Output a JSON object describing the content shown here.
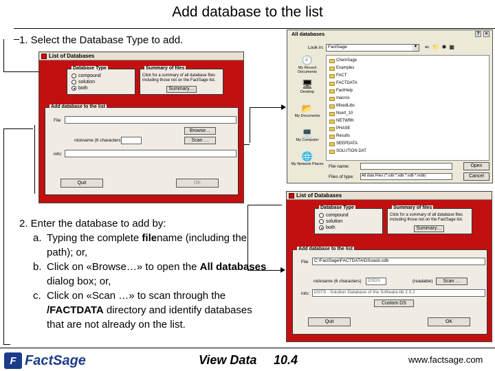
{
  "page": {
    "title": "Add database to the list",
    "step1": "1. Select the Database Type to add.",
    "step2": {
      "intro": "2. Enter the database to add by:",
      "items": [
        {
          "marker": "a.",
          "parts": [
            {
              "t": "Typing the complete ",
              "b": false
            },
            {
              "t": "file",
              "b": true
            },
            {
              "t": "name (including the path); or,",
              "b": false
            }
          ]
        },
        {
          "marker": "b.",
          "parts": [
            {
              "t": "Click on «Browse…» to open the ",
              "b": false
            },
            {
              "t": "All databases",
              "b": true
            },
            {
              "t": " dialog box; or,",
              "b": false
            }
          ]
        },
        {
          "marker": "c.",
          "parts": [
            {
              "t": "Click on «Scan …» to scan through the ",
              "b": false
            },
            {
              "t": "/FACTDATA",
              "b": true
            },
            {
              "t": " directory and identify databases that are not already on the list.",
              "b": false
            }
          ]
        }
      ]
    },
    "footer": {
      "logo": "FactSage",
      "view_data": "View Data",
      "page_number": "10.4",
      "url": "www.factsage.com"
    }
  },
  "dialog1": {
    "title": "List of Databases",
    "db_type_legend": "Database Type",
    "radios": [
      {
        "label": "compound",
        "checked": false
      },
      {
        "label": "solution",
        "checked": false
      },
      {
        "label": "both",
        "checked": true
      }
    ],
    "summary_legend": "Summary of files",
    "summary_text": "Click for a summary of all database files including those not on the FactSage list.",
    "summary_button": "Summary…",
    "add_legend": "Add database to the list",
    "file_label": "File",
    "file_value": "",
    "nick_label": "nickname (6 characters)",
    "nick_value": "",
    "info_label": "info:",
    "browse_button": "Browse…",
    "scan_button": "Scan …",
    "quit_button": "Quit",
    "ok_button": "OK"
  },
  "file_dialog": {
    "title": "All databases",
    "lookin_label": "Look in:",
    "lookin_value": "FactSage",
    "places": [
      "My Recent Documents",
      "Desktop",
      "My Documents",
      "My Computer",
      "My Network Places"
    ],
    "files": [
      "ChemSage",
      "Examples",
      "FACT",
      "FACTDATA",
      "FactHelp",
      "macros",
      "MixedLibs",
      "Nsert_10",
      "NETWRK",
      "PHASE",
      "Results",
      "SEEPDATA",
      "SOLUTION DAT"
    ],
    "filename_label": "File name:",
    "filetype_label": "Files of type:",
    "filetype_value": "All data Files (*.cdb *.sdb *.odb *.mdb)",
    "open_button": "Open",
    "cancel_button": "Cancel"
  },
  "dialog2": {
    "title": "List of Databases",
    "db_type_legend": "Database Type",
    "radios": [
      {
        "label": "compound",
        "checked": false
      },
      {
        "label": "solution",
        "checked": false
      },
      {
        "label": "both",
        "checked": true
      }
    ],
    "summary_legend": "Summary of files",
    "summary_text": "Click for a summary of all database files including those not on the FactSage list.",
    "summary_button": "Summary…",
    "add_legend": "Add database to the list",
    "file_label": "File",
    "file_value": "C:\\FactSage\\FACTDATA\\DSoasb.cdb",
    "nick_label": "nickname (6 characters)",
    "nick_value": "DSDS",
    "nick_suffix": "(readable)",
    "info_label": "info:",
    "info_value": "DSTS - Solution Database of the Software-lib 2.3.2",
    "scan_button": "Scan …",
    "custom_button": "Custom DS",
    "quit_button": "Quit",
    "ok_button": "OK"
  }
}
